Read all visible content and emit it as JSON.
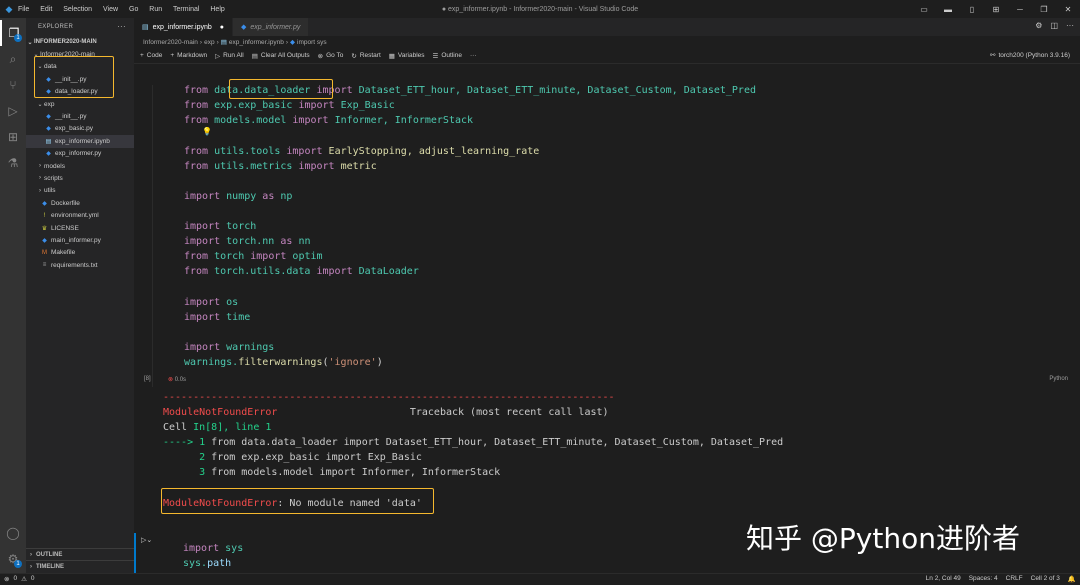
{
  "titlebar": {
    "menu": [
      "File",
      "Edit",
      "Selection",
      "View",
      "Go",
      "Run",
      "Terminal",
      "Help"
    ],
    "title": "● exp_informer.ipynb - Informer2020-main - Visual Studio Code"
  },
  "activity_badges": {
    "explorer": "1",
    "accounts_settings": "1"
  },
  "sidebar": {
    "header": "EXPLORER",
    "root": "INFORMER2020-MAIN",
    "subroot": "Informer2020-main",
    "items": [
      {
        "label": "data",
        "type": "folder-open"
      },
      {
        "label": "__init__.py",
        "type": "py"
      },
      {
        "label": "data_loader.py",
        "type": "py"
      },
      {
        "label": "exp",
        "type": "folder-open"
      },
      {
        "label": "__init__.py",
        "type": "py"
      },
      {
        "label": "exp_basic.py",
        "type": "py"
      },
      {
        "label": "exp_informer.ipynb",
        "type": "nb"
      },
      {
        "label": "exp_informer.py",
        "type": "py"
      },
      {
        "label": "models",
        "type": "folder"
      },
      {
        "label": "scripts",
        "type": "folder"
      },
      {
        "label": "utils",
        "type": "folder"
      },
      {
        "label": "Dockerfile",
        "type": "dock"
      },
      {
        "label": "environment.yml",
        "type": "yml"
      },
      {
        "label": "LICENSE",
        "type": "lic"
      },
      {
        "label": "main_informer.py",
        "type": "py"
      },
      {
        "label": "Makefile",
        "type": "mk"
      },
      {
        "label": "requirements.txt",
        "type": "txt"
      }
    ],
    "outline": "OUTLINE",
    "timeline": "TIMELINE"
  },
  "tabs": [
    {
      "label": "exp_informer.ipynb",
      "active": true
    },
    {
      "label": "exp_informer.py",
      "active": false
    }
  ],
  "breadcrumb": [
    "Informer2020-main",
    "exp",
    "exp_informer.ipynb",
    "import sys"
  ],
  "toolbar": {
    "code": "Code",
    "markdown": "Markdown",
    "run_all": "Run All",
    "clear_outputs": "Clear All Outputs",
    "goto": "Go To",
    "restart": "Restart",
    "variables": "Variables",
    "outline": "Outline",
    "kernel": "torch200 (Python 3.9.16)"
  },
  "cell1": {
    "exec_count": "[8]",
    "status_time": "0.0s",
    "language": "Python",
    "lines": {
      "l1_a": "data.data_loader",
      "l1_b": "Dataset_ETT_hour, Dataset_ETT_minute, Dataset_Custom, Dataset_Pred",
      "l2_a": "exp.exp_basic",
      "l2_b": "Exp_Basic",
      "l3_a": "models.model",
      "l3_b": "Informer, InformerStack",
      "l4_a": "utils.tools",
      "l4_b": "EarlyStopping, adjust_learning_rate",
      "l5_a": "utils.metrics",
      "l5_b": "metric",
      "l6_a": "numpy",
      "l6_b": "np",
      "l7": "torch",
      "l8_a": "torch.nn",
      "l8_b": "nn",
      "l9_a": "torch",
      "l9_b": "optim",
      "l10_a": "torch.utils.data",
      "l10_b": "DataLoader",
      "l11": "os",
      "l12": "time",
      "l13": "warnings",
      "l14_a": "warnings.",
      "l14_b": "filterwarnings",
      "l14_c": "'ignore'"
    }
  },
  "output": {
    "dashes": "---------------------------------------------------------------------------",
    "err_name": "ModuleNotFoundError",
    "traceback": "Traceback (most recent call last)",
    "cell_prefix": "Cell ",
    "cell_ref": "In[8], line 1",
    "arrow": "----> 1",
    "tb1": " from data.data_loader import Dataset_ETT_hour, Dataset_ETT_minute, Dataset_Custom, Dataset_Pred",
    "n2": "      2",
    "tb2": " from exp.exp_basic import Exp_Basic",
    "n3": "      3",
    "tb3": " from models.model import Informer, InformerStack",
    "final_err": "ModuleNotFoundError",
    "final_msg": ": No module named 'data'"
  },
  "cell2": {
    "line1": "sys",
    "line2_a": "sys.",
    "line2_b": "path"
  },
  "watermark": "知乎 @Python进阶者",
  "statusbar": {
    "errors": "0",
    "warnings": "0",
    "position": "Ln 2, Col 49",
    "spaces": "Spaces: 4",
    "eol": "CRLF",
    "cell": "Cell 2 of 3"
  }
}
